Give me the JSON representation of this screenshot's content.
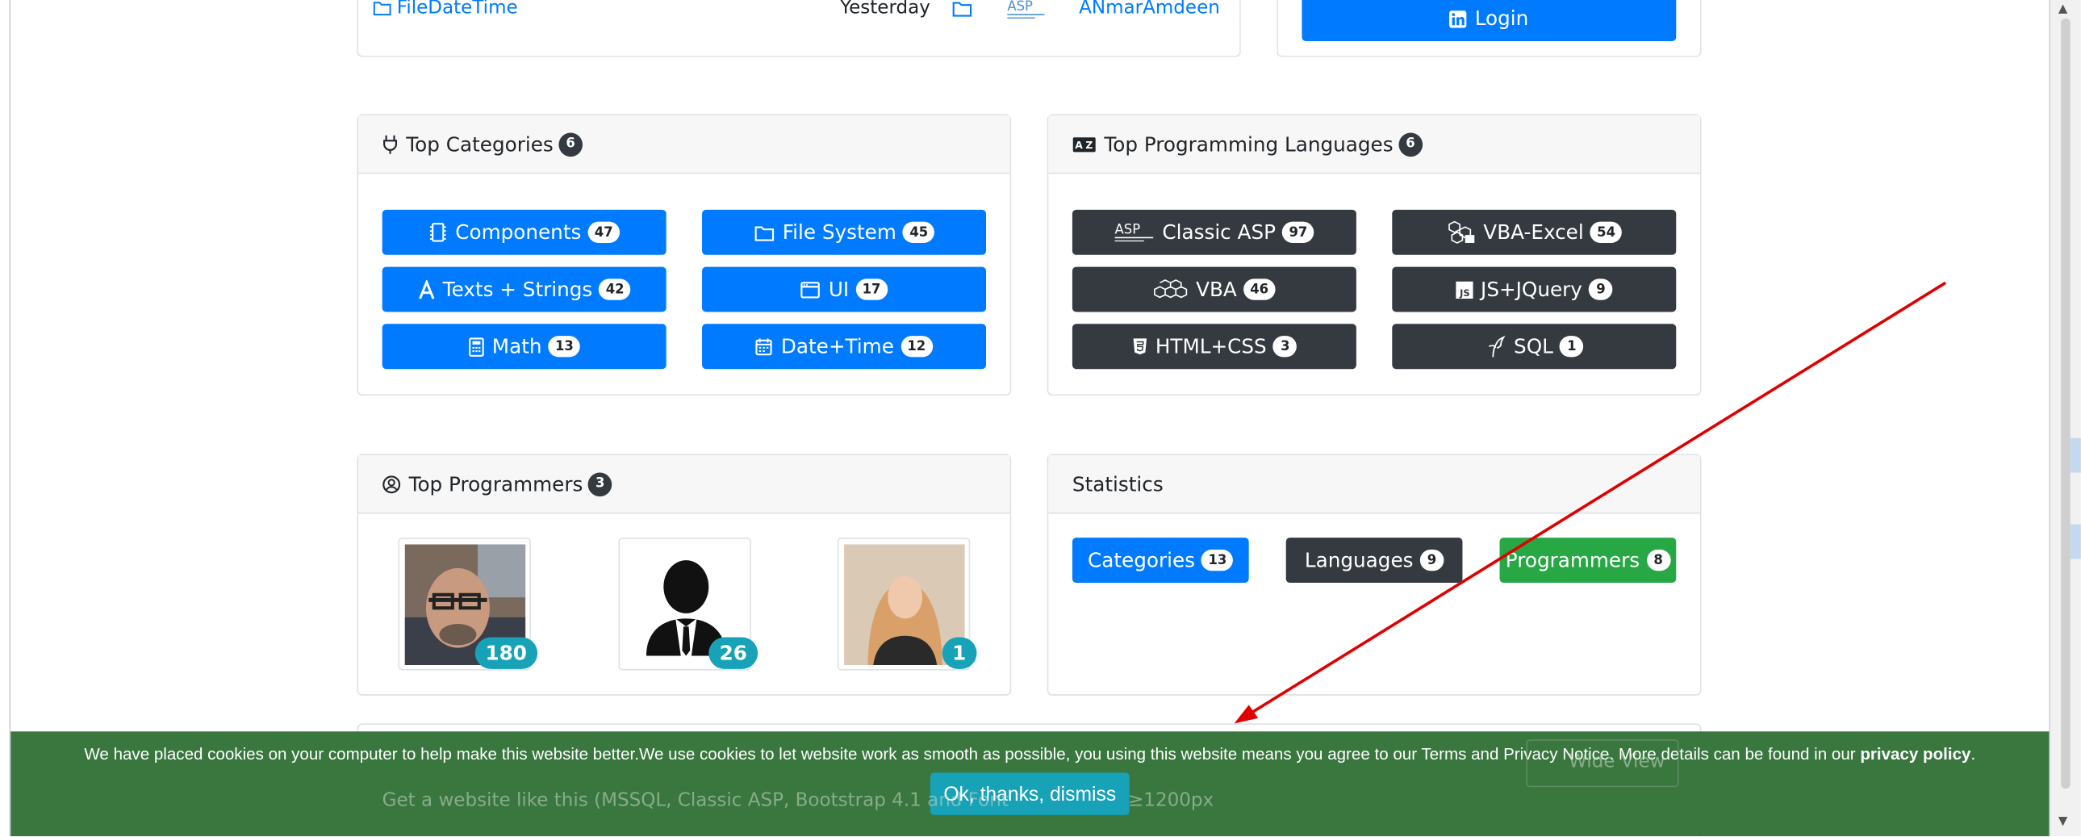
{
  "top_strip": {
    "file_link": "FileDateTime",
    "date": "Yesterday",
    "author": "ANmarAmdeen",
    "login_button": "Login"
  },
  "categories": {
    "title": "Top Categories",
    "count": "6",
    "items": [
      {
        "label": "Components",
        "count": "47",
        "icon": "chip-icon"
      },
      {
        "label": "File System",
        "count": "45",
        "icon": "folder-icon"
      },
      {
        "label": "Texts + Strings",
        "count": "42",
        "icon": "font-icon"
      },
      {
        "label": "UI",
        "count": "17",
        "icon": "window-icon"
      },
      {
        "label": "Math",
        "count": "13",
        "icon": "calculator-icon"
      },
      {
        "label": "Date+Time",
        "count": "12",
        "icon": "calendar-icon"
      }
    ]
  },
  "languages": {
    "title": "Top Programming Languages",
    "count": "6",
    "items": [
      {
        "label": "Classic ASP",
        "count": "97",
        "icon": "asp-logo-icon"
      },
      {
        "label": "VBA-Excel",
        "count": "54",
        "icon": "excel-cubes-icon"
      },
      {
        "label": "VBA",
        "count": "46",
        "icon": "vba-cubes-icon"
      },
      {
        "label": "JS+JQuery",
        "count": "9",
        "icon": "js-icon"
      },
      {
        "label": "HTML+CSS",
        "count": "3",
        "icon": "html5-icon"
      },
      {
        "label": "SQL",
        "count": "1",
        "icon": "sql-icon"
      }
    ]
  },
  "programmers": {
    "title": "Top Programmers",
    "count": "3",
    "items": [
      {
        "count": "180"
      },
      {
        "count": "26"
      },
      {
        "count": "1"
      }
    ]
  },
  "statistics": {
    "title": "Statistics",
    "buttons": [
      {
        "label": "Categories",
        "count": "13"
      },
      {
        "label": "Languages",
        "count": "9"
      },
      {
        "label": "Programmers",
        "count": "8"
      }
    ]
  },
  "footer_card": {
    "text": "Get a website like this (MSSQL, Classic ASP, Bootstrap 4.1 and Font",
    "width_hint": "≥1200px",
    "wide_view": "Wide View"
  },
  "cookie": {
    "message": "We have placed cookies on your computer to help make this website better.We use cookies to let website work as smooth as possible, you using this website means you agree to our Terms and Privacy Notice. More details can be found in our ",
    "policy_link": "privacy policy",
    "period": ".",
    "dismiss": "Ok, thanks, dismiss"
  },
  "colors": {
    "primary": "#007bff",
    "dark": "#343a40",
    "success": "#28a745",
    "info": "#17a2b8",
    "cookie_bg": "#39773f",
    "annotation_arrow": "#e00000"
  }
}
